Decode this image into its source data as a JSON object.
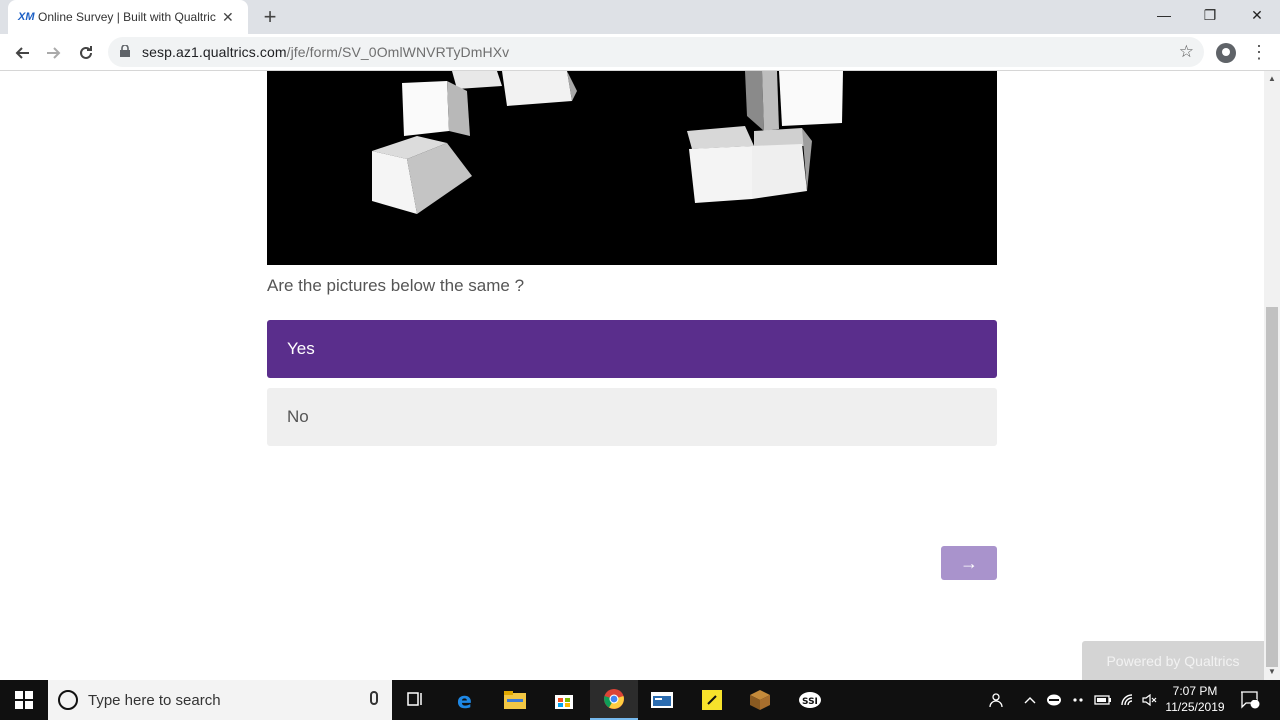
{
  "browser": {
    "tab_favicon": "XM",
    "tab_title": "Online Survey | Built with Qualtrics",
    "tab_close": "✕",
    "new_tab": "+",
    "url_host": "sesp.az1.qualtrics.com",
    "url_path": "/jfe/form/SV_0OmlWNVRTyDmHXv",
    "icons": [
      "back-icon",
      "forward-icon",
      "reload-icon",
      "lock-icon",
      "star-icon",
      "account-icon",
      "menu-icon"
    ]
  },
  "window_controls": {
    "minimize": "—",
    "restore": "❐",
    "close": "✕"
  },
  "survey": {
    "question": "Are the pictures below the same ?",
    "choices": [
      {
        "label": "Yes",
        "selected": true
      },
      {
        "label": "No",
        "selected": false
      }
    ],
    "next_label": "→",
    "powered_by": "Powered by Qualtrics",
    "accent_color": "#5a2e8c"
  },
  "taskbar": {
    "search_placeholder": "Type here to search",
    "time": "7:07 PM",
    "date": "11/25/2019",
    "notification_count": "1",
    "pinned_icons": [
      "task-view-icon",
      "edge-icon",
      "file-explorer-icon",
      "store-icon",
      "chrome-icon",
      "window-app-icon",
      "sticky-notes-icon",
      "minecraft-icon",
      "ssi-icon"
    ]
  }
}
